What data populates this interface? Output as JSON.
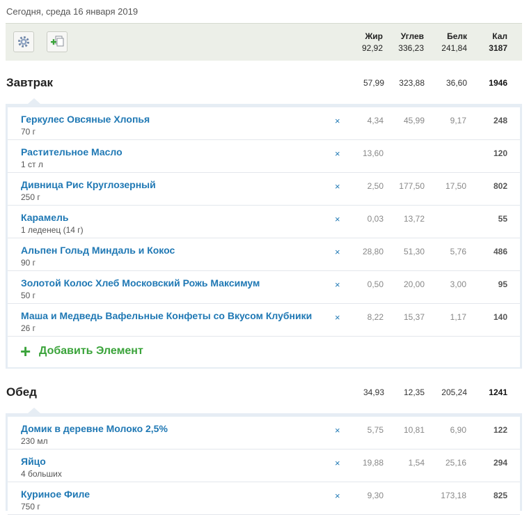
{
  "date_label": "Сегодня, среда 16 января 2019",
  "colors": {
    "link": "#1f78b4",
    "add": "#3aa33a",
    "toolbar_bg": "#ecefe8",
    "meal_frame": "#e6edf4"
  },
  "toolbar": {
    "settings_icon": "gear-icon",
    "copy_icon": "add-copy-icon",
    "headers": {
      "fat": "Жир",
      "carbs": "Углев",
      "protein": "Белк",
      "cal": "Кал"
    },
    "totals": {
      "fat": "92,92",
      "carbs": "336,23",
      "protein": "241,84",
      "cal": "3187"
    }
  },
  "meals": [
    {
      "title": "Завтрак",
      "totals": {
        "fat": "57,99",
        "carbs": "323,88",
        "protein": "36,60",
        "cal": "1946"
      },
      "items": [
        {
          "name": "Геркулес Овсяные Хлопья",
          "portion": "70 г",
          "fat": "4,34",
          "carbs": "45,99",
          "protein": "9,17",
          "cal": "248"
        },
        {
          "name": "Растительное Масло",
          "portion": "1 ст л",
          "fat": "13,60",
          "carbs": "",
          "protein": "",
          "cal": "120"
        },
        {
          "name": "Дивница Рис Круглозерный",
          "portion": "250 г",
          "fat": "2,50",
          "carbs": "177,50",
          "protein": "17,50",
          "cal": "802"
        },
        {
          "name": "Карамель",
          "portion": "1 леденец (14 г)",
          "fat": "0,03",
          "carbs": "13,72",
          "protein": "",
          "cal": "55"
        },
        {
          "name": "Альпен Гольд Миндаль и Кокос",
          "portion": "90 г",
          "fat": "28,80",
          "carbs": "51,30",
          "protein": "5,76",
          "cal": "486"
        },
        {
          "name": "Золотой Колос Хлеб Московский Рожь Максимум",
          "portion": "50 г",
          "fat": "0,50",
          "carbs": "20,00",
          "protein": "3,00",
          "cal": "95"
        },
        {
          "name": "Маша и Медведь Вафельные Конфеты со Вкусом Клубники",
          "portion": "26 г",
          "fat": "8,22",
          "carbs": "15,37",
          "protein": "1,17",
          "cal": "140"
        }
      ],
      "add_label": "Добавить Элемент",
      "delete_symbol": "×"
    },
    {
      "title": "Обед",
      "totals": {
        "fat": "34,93",
        "carbs": "12,35",
        "protein": "205,24",
        "cal": "1241"
      },
      "items": [
        {
          "name": "Домик в деревне Молоко 2,5%",
          "portion": "230 мл",
          "fat": "5,75",
          "carbs": "10,81",
          "protein": "6,90",
          "cal": "122"
        },
        {
          "name": "Яйцо",
          "portion": "4 больших",
          "fat": "19,88",
          "carbs": "1,54",
          "protein": "25,16",
          "cal": "294"
        },
        {
          "name": "Куриное Филе",
          "portion": "750 г",
          "fat": "9,30",
          "carbs": "",
          "protein": "173,18",
          "cal": "825"
        }
      ],
      "delete_symbol": "×"
    }
  ]
}
